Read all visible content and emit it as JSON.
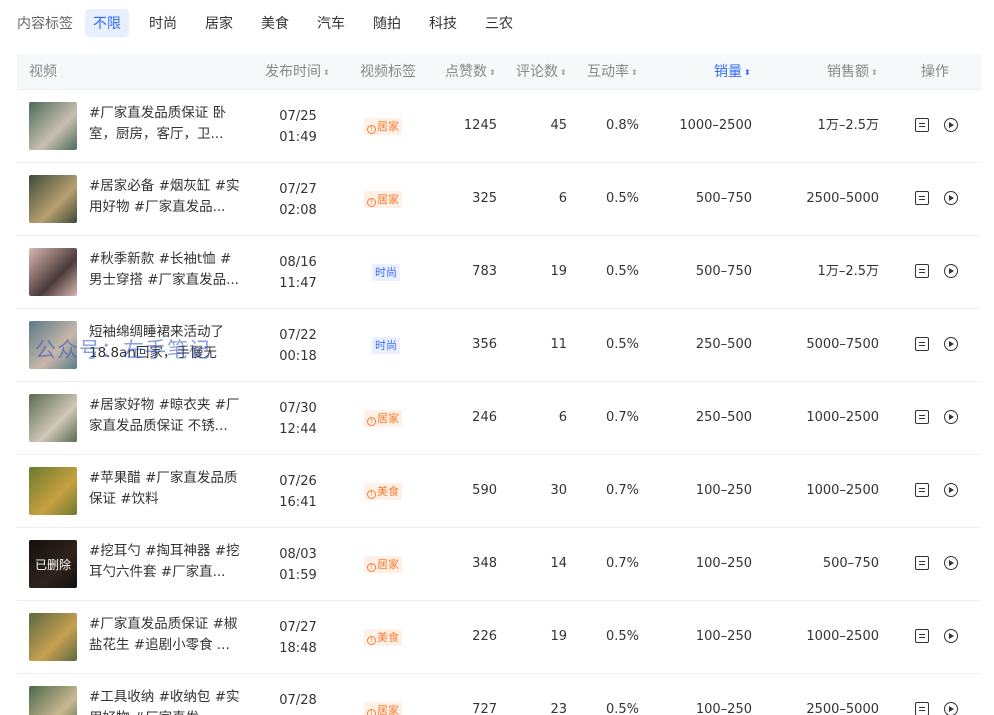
{
  "filter": {
    "label": "内容标签",
    "chips": [
      "不限",
      "时尚",
      "居家",
      "美食",
      "汽车",
      "随拍",
      "科技",
      "三农"
    ],
    "active_index": 0
  },
  "table": {
    "headers": {
      "video": "视频",
      "publish_time": "发布时间",
      "video_tag": "视频标签",
      "likes": "点赞数",
      "comments": "评论数",
      "interaction_rate": "互动率",
      "sales": "销量",
      "sales_amount": "销售额",
      "actions": "操作"
    },
    "sort_icon": "⬍",
    "rows": [
      {
        "title": "#厂家直发品质保证 卧室，厨房，客厅，卫...",
        "date": "07/25",
        "time": "01:49",
        "tag": "居家",
        "tag_color": "orange",
        "likes": "1245",
        "comments": "45",
        "rate": "0.8%",
        "sales": "1000–2500",
        "amount": "1万–2.5万",
        "thumb": [
          "#4a6b5a",
          "#c9c0b0"
        ],
        "deleted": ""
      },
      {
        "title": "#居家必备 #烟灰缸 #实用好物 #厂家直发品...",
        "date": "07/27",
        "time": "02:08",
        "tag": "居家",
        "tag_color": "orange",
        "likes": "325",
        "comments": "6",
        "rate": "0.5%",
        "sales": "500–750",
        "amount": "2500–5000",
        "thumb": [
          "#3d4a3a",
          "#b8a070"
        ],
        "deleted": ""
      },
      {
        "title": "#秋季新款 #长袖t恤 #男士穿搭 #厂家直发品...",
        "date": "08/16",
        "time": "11:47",
        "tag": "时尚",
        "tag_color": "blue",
        "likes": "783",
        "comments": "19",
        "rate": "0.5%",
        "sales": "500–750",
        "amount": "1万–2.5万",
        "thumb": [
          "#d9b8b0",
          "#4a3a3a"
        ],
        "deleted": ""
      },
      {
        "title": "短袖绵绸睡裙来活动了 18.8an回家，手慢无#...",
        "date": "07/22",
        "time": "00:18",
        "tag": "时尚",
        "tag_color": "blue",
        "likes": "356",
        "comments": "11",
        "rate": "0.5%",
        "sales": "250–500",
        "amount": "5000–7500",
        "thumb": [
          "#5b7a8a",
          "#c8b8a8"
        ],
        "deleted": ""
      },
      {
        "title": "#居家好物 #晾衣夹 #厂家直发品质保证 不锈...",
        "date": "07/30",
        "time": "12:44",
        "tag": "居家",
        "tag_color": "orange",
        "likes": "246",
        "comments": "6",
        "rate": "0.7%",
        "sales": "250–500",
        "amount": "1000–2500",
        "thumb": [
          "#5a6a50",
          "#d0c8b8"
        ],
        "deleted": ""
      },
      {
        "title": "#苹果醋 #厂家直发品质保证 #饮料",
        "date": "07/26",
        "time": "16:41",
        "tag": "美食",
        "tag_color": "orange",
        "likes": "590",
        "comments": "30",
        "rate": "0.7%",
        "sales": "100–250",
        "amount": "1000–2500",
        "thumb": [
          "#6a7a30",
          "#c8a040"
        ],
        "deleted": ""
      },
      {
        "title": "#挖耳勺 #掏耳神器 #挖耳勺六件套 #厂家直...",
        "date": "08/03",
        "time": "01:59",
        "tag": "居家",
        "tag_color": "orange",
        "likes": "348",
        "comments": "14",
        "rate": "0.7%",
        "sales": "100–250",
        "amount": "500–750",
        "thumb": [
          "#2a2522",
          "#6a5040"
        ],
        "deleted": "已删除"
      },
      {
        "title": "#厂家直发品质保证 #椒盐花生 #追剧小零食 ...",
        "date": "07/27",
        "time": "18:48",
        "tag": "美食",
        "tag_color": "orange",
        "likes": "226",
        "comments": "19",
        "rate": "0.5%",
        "sales": "100–250",
        "amount": "1000–2500",
        "thumb": [
          "#5a6a40",
          "#c8a050"
        ],
        "deleted": ""
      },
      {
        "title": "#工具收纳 #收纳包 #实用好物 #厂家直发...",
        "date": "07/28",
        "time": "",
        "tag": "居家",
        "tag_color": "orange",
        "likes": "727",
        "comments": "23",
        "rate": "0.5%",
        "sales": "100–250",
        "amount": "2500–5000",
        "thumb": [
          "#4a6a4a",
          "#c8b890"
        ],
        "deleted": ""
      }
    ]
  },
  "watermark": "公众号：左手笔记"
}
